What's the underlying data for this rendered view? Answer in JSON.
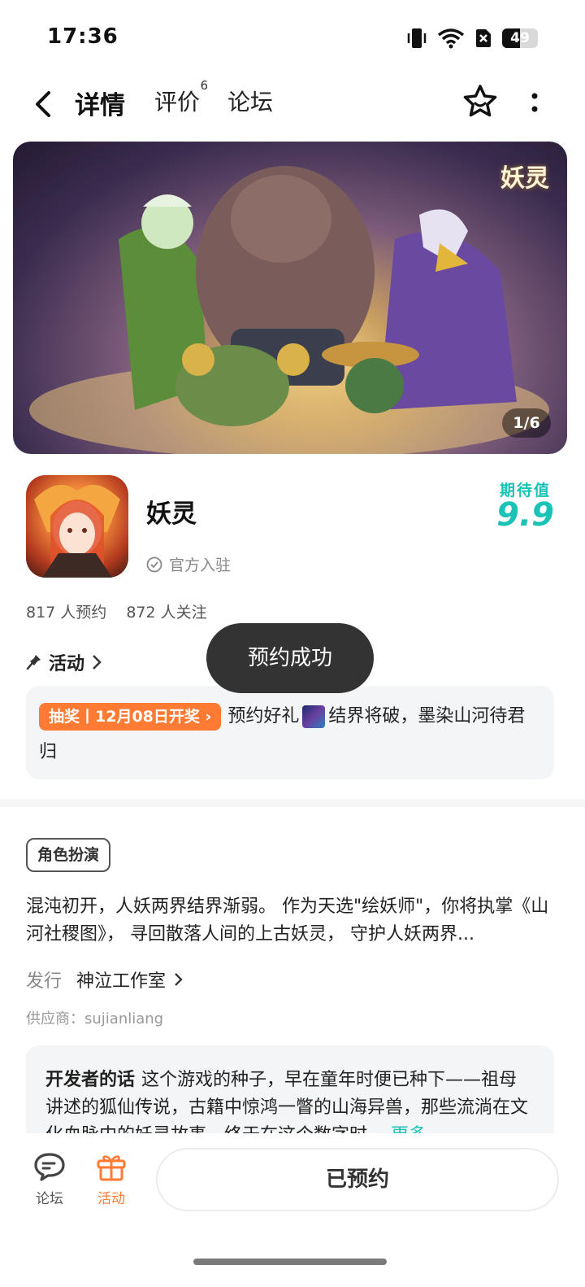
{
  "status_bar": {
    "time": "17:36",
    "battery": "49",
    "battery_level": 0.49
  },
  "nav": {
    "tabs": [
      {
        "label": "详情",
        "active": true
      },
      {
        "label": "评价",
        "badge": "6"
      },
      {
        "label": "论坛"
      }
    ]
  },
  "banner": {
    "logo_text": "妖灵",
    "counter": "1/6"
  },
  "game": {
    "title": "妖灵",
    "official_label": "官方入驻",
    "score_label": "期待值",
    "score": "9.9",
    "reservations": "817 人预约",
    "followers": "872 人关注"
  },
  "activity": {
    "heading": "活动",
    "lottery_tag": "抽奖丨12月08日开奖",
    "text_part1": "预约好礼",
    "text_part2": "结界将破，墨染山河待君归"
  },
  "toast": "预约成功",
  "details": {
    "genre": "角色扮演",
    "description": "混沌初开，人妖两界结界渐弱。 作为天选\"绘妖师\"，你将执掌《山河社稷图》， 寻回散落人间的上古妖灵， 守护人妖两界...",
    "publisher_label": "发行",
    "publisher": "神泣工作室",
    "supplier": "供应商：sujianliang",
    "dev_label": "开发者的话",
    "dev_text": "这个游戏的种子，早在童年时便已种下——祖母讲述的狐仙传说，古籍中惊鸿一瞥的山海异兽，那些流淌在文化血脉中的妖灵故事，终于在这个数字时…",
    "dev_more": "更多"
  },
  "bottom_bar": {
    "forum_label": "论坛",
    "activity_label": "活动",
    "reserved_button": "已预约"
  },
  "colors": {
    "accent": "#1bc3b6",
    "orange": "#ff7a33",
    "toast_bg": "#333333"
  }
}
